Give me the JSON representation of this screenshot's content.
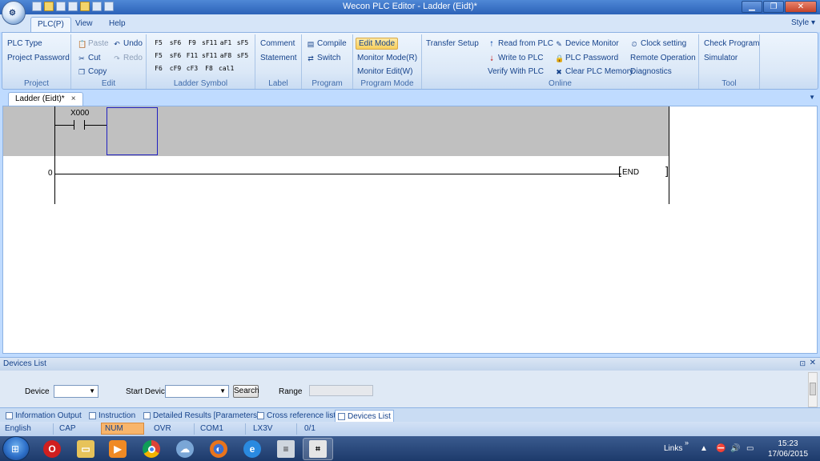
{
  "window": {
    "title": "Wecon PLC Editor - Ladder (Eidt)*"
  },
  "window_controls": {
    "minimize": "▁",
    "maximize": "❐",
    "close": "✕"
  },
  "menu": {
    "tabs": [
      "PLC(P)",
      "View",
      "Help"
    ],
    "style_label": "Style"
  },
  "ribbon": {
    "project": {
      "label": "Project",
      "plc_type": "PLC Type",
      "project_password": "Project Password"
    },
    "edit": {
      "label": "Edit",
      "paste": "Paste",
      "undo": "Undo",
      "cut": "Cut",
      "redo": "Redo",
      "copy": "Copy"
    },
    "ladder_symbol": {
      "label": "Ladder Symbol",
      "symbols": [
        "F5",
        "sF6",
        "F9",
        "sF11",
        "aF1",
        "sF5",
        "F5",
        "sF6",
        "F11",
        "sF11",
        "aF8",
        "sF5",
        "F6",
        "cF9",
        "cF3",
        "F8",
        "cal1",
        ""
      ]
    },
    "label_group": {
      "label": "Label",
      "comment": "Comment",
      "statement": "Statement"
    },
    "program": {
      "label": "Program",
      "compile": "Compile",
      "switch": "Switch"
    },
    "program_mode": {
      "label": "Program Mode",
      "edit_mode": "Edit Mode",
      "monitor_mode": "Monitor Mode(R)",
      "monitor_edit": "Monitor Edit(W)"
    },
    "online": {
      "label": "Online",
      "transfer_setup": "Transfer Setup",
      "read_from_plc": "Read from PLC",
      "write_to_plc": "Write to PLC",
      "verify_with_plc": "Verify With PLC",
      "device_monitor": "Device Monitor",
      "plc_password": "PLC Password",
      "clear_plc_memory": "Clear PLC Memory",
      "clock_setting": "Clock setting",
      "remote_operation": "Remote Operation",
      "diagnostics": "Diagnostics"
    },
    "tool": {
      "label": "Tool",
      "check_program": "Check Program",
      "simulator": "Simulator"
    }
  },
  "document_tab": {
    "label": "Ladder (Eidt)*",
    "close": "×"
  },
  "ladder": {
    "contact_device": "X000",
    "rung_number": "0",
    "end_instruction": "END"
  },
  "devices_list": {
    "title": "Devices List",
    "device_label": "Device",
    "device_value": "",
    "start_device_label": "Start Device",
    "start_device_value": "",
    "search_button": "Search",
    "range_label": "Range",
    "range_value": ""
  },
  "bottom_tabs": [
    "Information Output",
    "Instruction",
    "Detailed Results [Parameters]",
    "Cross reference list",
    "Devices List"
  ],
  "active_bottom_tab": "Devices List",
  "status_bar": {
    "language": "English",
    "caps": "CAP",
    "num": "NUM",
    "ovr": "OVR",
    "port": "COM1",
    "plc_model": "LX3V",
    "position": "0/1"
  },
  "taskbar": {
    "links": "Links",
    "time": "15:23",
    "date": "17/06/2015",
    "apps": [
      "opera-icon",
      "explorer-icon",
      "media-player-icon",
      "chrome-icon",
      "network-icon",
      "firefox-icon",
      "internet-explorer-icon",
      "clipboard-icon",
      "wecon-plc-editor-icon"
    ]
  },
  "colors": {
    "ribbon_text": "#15428b",
    "rung_selection": "#c0c0c0",
    "active_mode": "#f8cf5d",
    "num_indicator": "#f8b56b"
  }
}
